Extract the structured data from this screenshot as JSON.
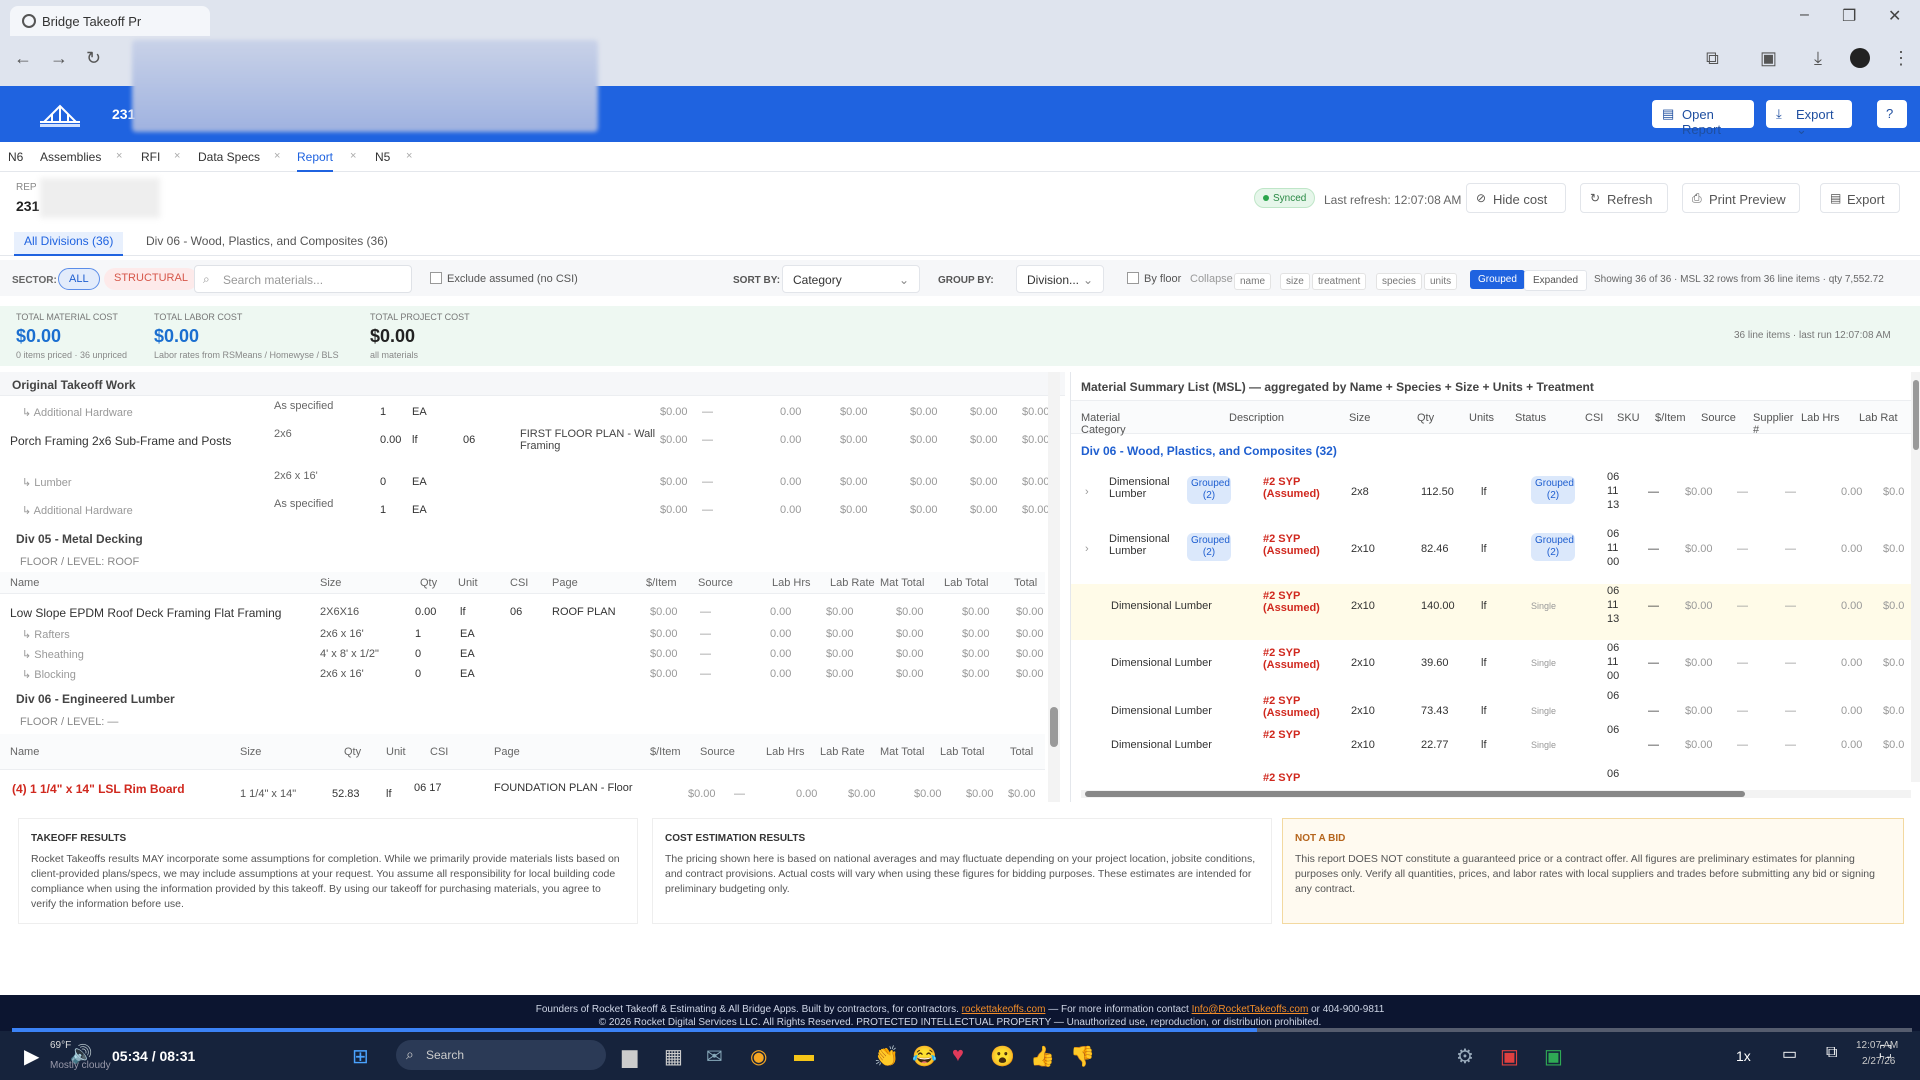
{
  "browser": {
    "tab_title": "Bridge Takeoff Pr"
  },
  "app": {
    "project_code": "231",
    "open_report": "Open Report",
    "export": "Export"
  },
  "tabs": [
    "N6",
    "Assemblies",
    "RFI",
    "Data Specs",
    "Report",
    "N5"
  ],
  "active_tab": "Report",
  "report_header": {
    "label": "REP",
    "code": "231"
  },
  "sync": {
    "status": "Synced",
    "last_refresh": "Last refresh: 12:07:08 AM"
  },
  "actions": {
    "hide_cost": "Hide cost",
    "refresh": "Refresh",
    "print_preview": "Print Preview",
    "export": "Export"
  },
  "division_tabs": [
    "All Divisions (36)",
    "Div 06 - Wood, Plastics, and Composites (36)"
  ],
  "filters": {
    "sector_label": "SECTOR:",
    "all": "ALL",
    "structural": "STRUCTURAL",
    "search_placeholder": "Search materials...",
    "exclude_assumed": "Exclude assumed (no CSI)",
    "sort_by_label": "SORT BY:",
    "sort_by": "Category",
    "group_by_label": "GROUP BY:",
    "group_by": "Division...",
    "by_floor": "By floor",
    "collapse": "Collapse",
    "chips": [
      "name",
      "size",
      "treatment",
      "species",
      "units"
    ],
    "grouped": "Grouped",
    "expanded": "Expanded",
    "showing": "Showing 36 of 36 · MSL 32 rows from 36 line items · qty 7,552.72"
  },
  "costs": {
    "material_label": "TOTAL MATERIAL COST",
    "material_value": "$0.00",
    "material_sub": "0 items priced · 36 unpriced",
    "labor_label": "TOTAL LABOR COST",
    "labor_value": "$0.00",
    "labor_sub": "Labor rates from RSMeans / Homewyse / BLS",
    "project_label": "TOTAL PROJECT COST",
    "project_value": "$0.00",
    "project_sub": "all materials",
    "right_note": "36 line items · last run 12:07:08 AM"
  },
  "left": {
    "section_title": "Original Takeoff Work",
    "rows1": [
      {
        "name": "↳ Additional Hardware",
        "size": "As specified",
        "qty": "1",
        "unit": "EA",
        "csi": "",
        "page": ""
      },
      {
        "name": "Porch Framing 2x6 Sub-Frame and Posts",
        "size": "2x6",
        "qty": "0.00",
        "unit": "lf",
        "csi": "06",
        "page": "FIRST FLOOR PLAN - Wall Framing"
      },
      {
        "name": "↳ Lumber",
        "size": "2x6 x 16'",
        "qty": "0",
        "unit": "EA",
        "csi": "",
        "page": ""
      },
      {
        "name": "↳ Additional Hardware",
        "size": "As specified",
        "qty": "1",
        "unit": "EA",
        "csi": "",
        "page": ""
      }
    ],
    "div05": "Div 05 - Metal Decking",
    "floor_roof": "FLOOR / LEVEL: ROOF",
    "headers": [
      "Name",
      "Size",
      "Qty",
      "Unit",
      "CSI",
      "Page",
      "$/Item",
      "Source",
      "Lab Hrs",
      "Lab Rate",
      "Mat Total",
      "Lab Total",
      "Total"
    ],
    "rows2": [
      {
        "name": "Low Slope EPDM Roof Deck Framing Flat Framing",
        "size": "2X6X16",
        "qty": "0.00",
        "unit": "lf",
        "csi": "06",
        "page": "ROOF PLAN"
      },
      {
        "name": "↳ Rafters",
        "size": "2x6 x 16'",
        "qty": "1",
        "unit": "EA",
        "csi": "",
        "page": ""
      },
      {
        "name": "↳ Sheathing",
        "size": "4' x 8' x 1/2\"",
        "qty": "0",
        "unit": "EA",
        "csi": "",
        "page": ""
      },
      {
        "name": "↳ Blocking",
        "size": "2x6 x 16'",
        "qty": "0",
        "unit": "EA",
        "csi": "",
        "page": ""
      }
    ],
    "div06": "Div 06 - Engineered Lumber",
    "floor_dash": "FLOOR / LEVEL: —",
    "headers2": [
      "Name",
      "Size",
      "Qty",
      "Unit",
      "CSI",
      "Page",
      "$/Item",
      "Source",
      "Lab Hrs",
      "Lab Rate",
      "Mat Total",
      "Lab Total",
      "Total"
    ],
    "row3": {
      "name": "(4) 1 1/4\" x 14\" LSL Rim Board",
      "size": "1 1/4\" x 14\"",
      "qty": "52.83",
      "unit": "lf",
      "csi": "06 17",
      "page": "FOUNDATION PLAN - Floor"
    },
    "money": "$0.00",
    "dash": "—",
    "zero": "0.00"
  },
  "right": {
    "title": "Material Summary List (MSL) — aggregated by Name + Species + Size + Units + Treatment",
    "headers": [
      "Material Category",
      "Description",
      "Size",
      "Qty",
      "Units",
      "Status",
      "CSI",
      "SKU",
      "$/Item",
      "Source",
      "Supplier #",
      "Lab Hrs",
      "Lab Rat"
    ],
    "group": "Div 06 - Wood, Plastics, and Composites (32)",
    "rows": [
      {
        "cat": "Dimensional Lumber",
        "badge": "Grouped (2)",
        "desc": "#2 SYP (Assumed)",
        "size": "2x8",
        "qty": "112.50",
        "units": "lf",
        "status": "Grouped (2)",
        "csi": "06 11 13"
      },
      {
        "cat": "Dimensional Lumber",
        "badge": "Grouped (2)",
        "desc": "#2 SYP (Assumed)",
        "size": "2x10",
        "qty": "82.46",
        "units": "lf",
        "status": "Grouped (2)",
        "csi": "06 11 00"
      },
      {
        "cat": "Dimensional Lumber",
        "badge": "",
        "desc": "#2 SYP (Assumed)",
        "size": "2x10",
        "qty": "140.00",
        "units": "lf",
        "status": "Single",
        "csi": "06 11 13"
      },
      {
        "cat": "Dimensional Lumber",
        "badge": "",
        "desc": "#2 SYP (Assumed)",
        "size": "2x10",
        "qty": "39.60",
        "units": "lf",
        "status": "Single",
        "csi": "06 11 00"
      },
      {
        "cat": "Dimensional Lumber",
        "badge": "",
        "desc": "#2 SYP (Assumed)",
        "size": "2x10",
        "qty": "73.43",
        "units": "lf",
        "status": "Single",
        "csi": "06"
      },
      {
        "cat": "Dimensional Lumber",
        "badge": "",
        "desc": "#2 SYP",
        "size": "2x10",
        "qty": "22.77",
        "units": "lf",
        "status": "Single",
        "csi": "06"
      }
    ],
    "last_row_desc": "#2 SYP",
    "last_row_csi": "06",
    "money": "$0.00",
    "dash": "—",
    "zero": "0.00",
    "cut": "$0.0"
  },
  "notes": {
    "takeoff_title": "TAKEOFF RESULTS",
    "takeoff_text": "Rocket Takeoffs results MAY incorporate some assumptions for completion. While we primarily provide materials lists based on client-provided plans/specs, we may include assumptions at your request. You assume all responsibility for local building code compliance when using the information provided by this takeoff. By using our takeoff for purchasing materials, you agree to verify the information before use.",
    "cost_title": "COST ESTIMATION RESULTS",
    "cost_text": "The pricing shown here is based on national averages and may fluctuate depending on your project location, jobsite conditions, and contract provisions. Actual costs will vary when using these figures for bidding purposes. These estimates are intended for preliminary budgeting only.",
    "bid_title": "NOT A BID",
    "bid_text": "This report DOES NOT constitute a guaranteed price or a contract offer. All figures are preliminary estimates for planning purposes only. Verify all quantities, prices, and labor rates with local suppliers and trades before submitting any bid or signing any contract."
  },
  "footer": {
    "line1a": "Founders of Rocket Takeoff & Estimating & All Bridge Apps. Built by contractors, for contractors.",
    "link1": "rockettakeoffs.com",
    "line1b": "— For more information contact",
    "link2": "Info@RocketTakeoffs.com",
    "line1c": "or 404-900-9811",
    "line2": "© 2026 Rocket Digital Services LLC. All Rights Reserved. PROTECTED INTELLECTUAL PROPERTY — Unauthorized use, reproduction, or distribution prohibited."
  },
  "player": {
    "time": "05:34 / 08:31",
    "speed": "1x",
    "weather": "69°F",
    "weather_sub": "Mostly cloudy",
    "clock": "12:07 AM",
    "date": "2/27/26",
    "search": "Search",
    "progress": 0.655
  }
}
